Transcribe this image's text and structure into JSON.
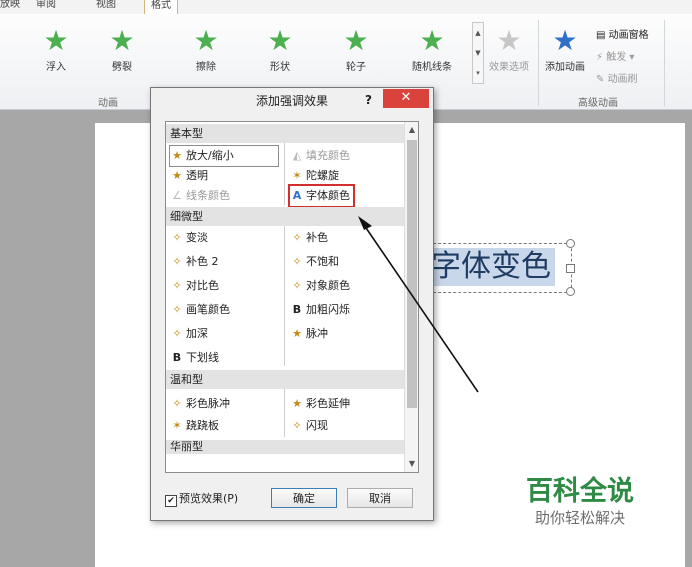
{
  "tabs": [
    "放映",
    "审阅",
    "视图",
    "格式"
  ],
  "ribbon": {
    "effects": [
      {
        "label": "浮入",
        "icon": "float-in-star-icon"
      },
      {
        "label": "劈裂",
        "icon": "split-star-icon"
      },
      {
        "label": "擦除",
        "icon": "wipe-star-icon"
      },
      {
        "label": "形状",
        "icon": "shape-star-icon"
      },
      {
        "label": "轮子",
        "icon": "wheel-star-icon"
      },
      {
        "label": "随机线条",
        "icon": "random-bars-star-icon"
      }
    ],
    "effect_options": "效果选项",
    "add_animation": "添加动画",
    "animation_pane": "动画窗格",
    "trigger": "触发",
    "animation_painter": "动画刷",
    "group_animation": "动画",
    "group_advanced": "高级动画",
    "accent_color": "#4caf50"
  },
  "dialog": {
    "title": "添加强调效果",
    "help": "?",
    "close": "✕",
    "categories": [
      "基本型",
      "细微型",
      "温和型",
      "华丽型"
    ],
    "basic_left": [
      "放大/缩小",
      "透明",
      "线条颜色"
    ],
    "basic_right": [
      "填充颜色",
      "陀螺旋",
      "字体颜色"
    ],
    "subtle_left": [
      "变淡",
      "补色 2",
      "对比色",
      "画笔颜色",
      "加深",
      "下划线"
    ],
    "subtle_right": [
      "补色",
      "不饱和",
      "对象颜色",
      "加粗闪烁",
      "脉冲"
    ],
    "moderate_left": [
      "彩色脉冲",
      "跷跷板"
    ],
    "moderate_right": [
      "彩色延伸",
      "闪现"
    ],
    "preview_label": "预览效果(P)",
    "preview_checked": "✔",
    "ok": "确定",
    "cancel": "取消",
    "highlight_color": "#d32f2f"
  },
  "slide": {
    "text": "字体变色"
  },
  "watermark": {
    "title": "百科全说",
    "subtitle": "助你轻松解决"
  }
}
